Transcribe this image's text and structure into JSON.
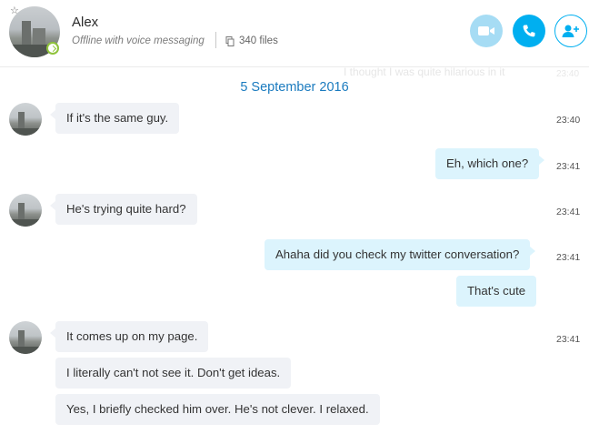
{
  "header": {
    "contact_name": "Alex",
    "status": "Offline with voice messaging",
    "files": "340 files",
    "icons": [
      "star-icon",
      "presence-icon",
      "files-icon",
      "video-call-icon",
      "audio-call-icon",
      "add-people-icon"
    ],
    "colors": {
      "accent": "#00aff0",
      "video_disabled": "#a6dcf4",
      "presence": "#8fc33b"
    }
  },
  "chat": {
    "ghost_message": "I thought I was quite hilarious in it",
    "ghost_time": "23:40",
    "date_separator": "5 September 2016",
    "messages": [
      {
        "dir": "in",
        "text": "If it's the same guy.",
        "time": "23:40"
      },
      {
        "dir": "out",
        "text": "Eh, which one?",
        "time": "23:41"
      },
      {
        "dir": "in",
        "text": "He's trying quite hard?",
        "time": "23:41"
      },
      {
        "dir": "out",
        "text": "Ahaha did you check my twitter conversation?",
        "time": "23:41"
      },
      {
        "dir": "out",
        "text": "That's cute",
        "time": ""
      },
      {
        "dir": "in",
        "text": "It comes up on my page.",
        "time": "23:41"
      },
      {
        "dir": "in",
        "text": "I literally can't not see it. Don't get ideas.",
        "time": ""
      },
      {
        "dir": "in",
        "text": "Yes, I briefly checked him over. He's not clever. I relaxed.",
        "time": ""
      }
    ]
  }
}
